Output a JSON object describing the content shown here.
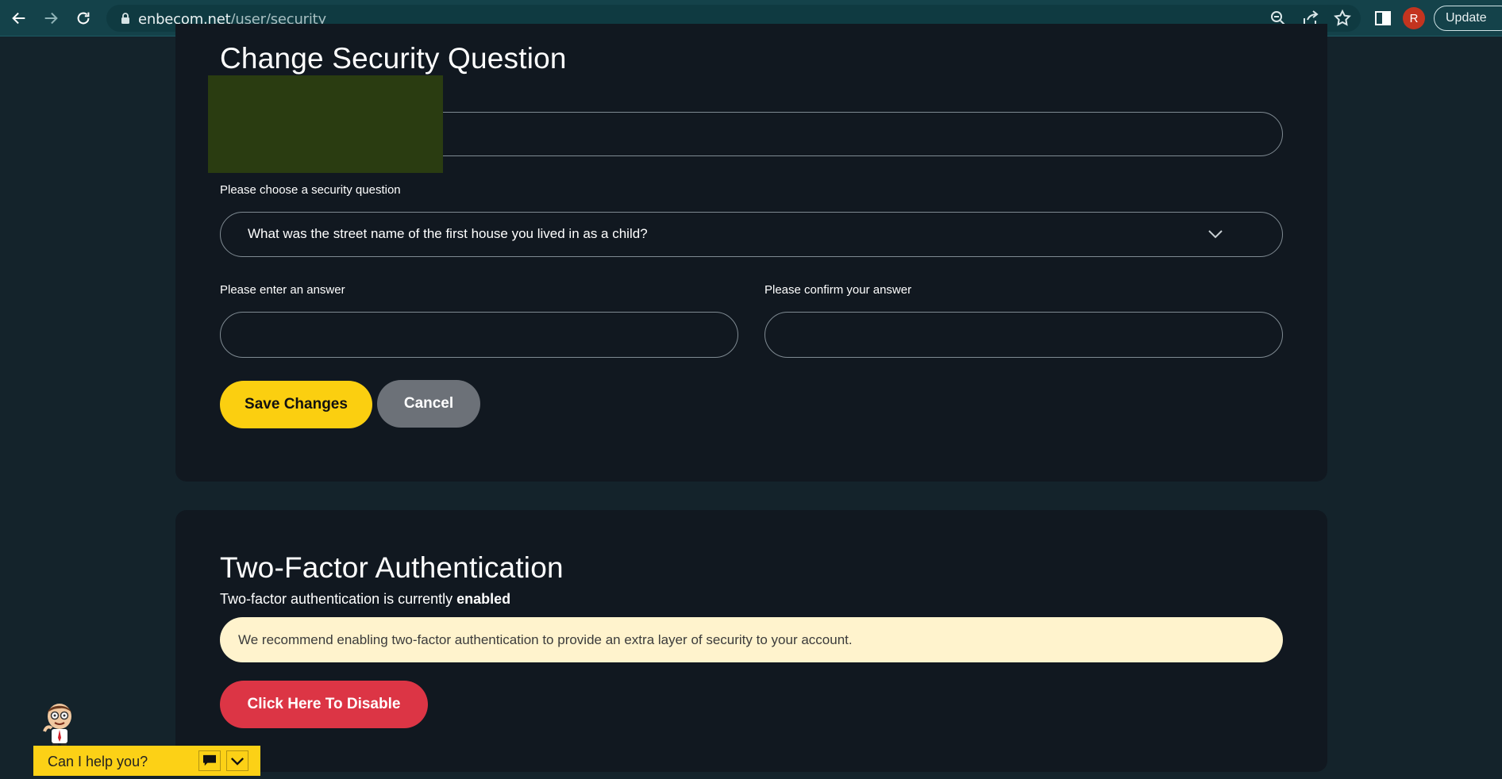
{
  "browser": {
    "url_domain": "enbecom.net",
    "url_path": "/user/security",
    "profile_initial": "R",
    "update_label": "Update"
  },
  "security_question": {
    "title": "Change Security Question",
    "question_label": "Please choose a security question",
    "selected_question": "What was the street name of the first house you lived in as a child?",
    "answer_label": "Please enter an answer",
    "answer_value": "",
    "confirm_label": "Please confirm your answer",
    "confirm_value": "",
    "save_label": "Save Changes",
    "cancel_label": "Cancel"
  },
  "two_factor": {
    "title": "Two-Factor Authentication",
    "status_prefix": "Two-factor authentication is currently",
    "status_value": "enabled",
    "notice": "We recommend enabling two-factor authentication to provide an extra layer of security to your account.",
    "disable_label": "Click Here To Disable"
  },
  "help_widget": {
    "prompt": "Can I help you?"
  },
  "colors": {
    "page_bg": "#14232b",
    "card_bg": "#111820",
    "save_button": "#fbcf10",
    "cancel_button": "#6c7178",
    "disable_button": "#dc3545",
    "notice_bg": "#fff3cd",
    "help_bar": "#fcd116"
  }
}
